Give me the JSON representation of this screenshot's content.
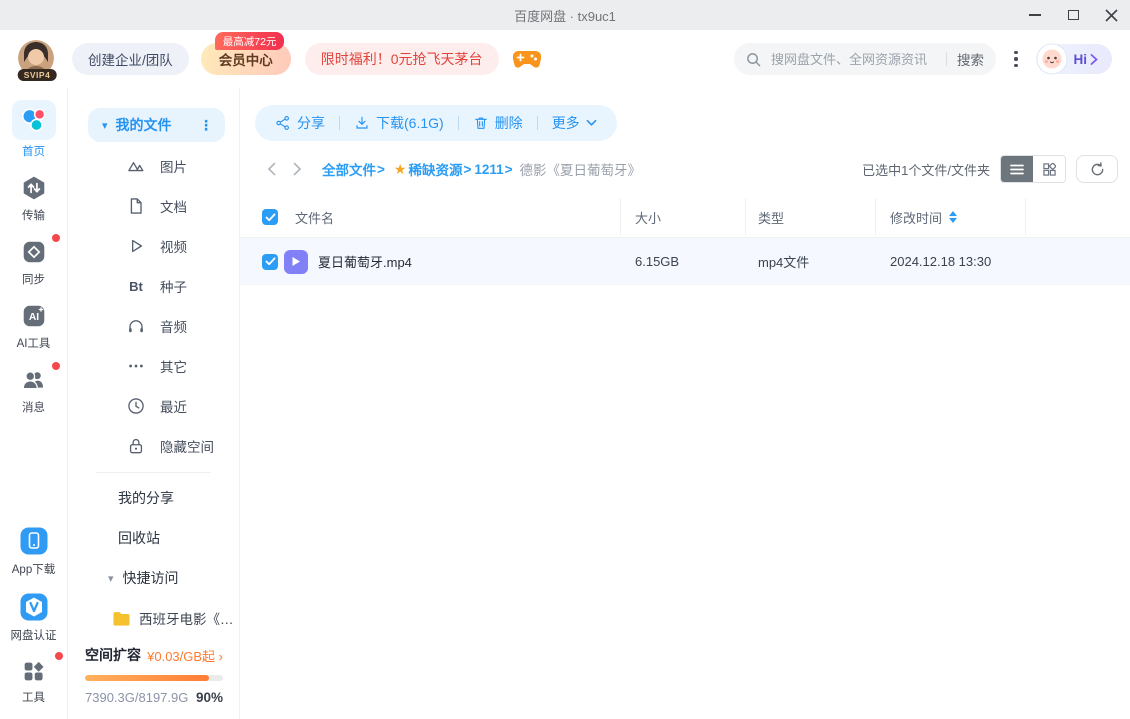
{
  "window": {
    "title": "百度网盘 · tx9uc1"
  },
  "header": {
    "avatar_badge": "SVIP4",
    "create_team": "创建企业/团队",
    "vip_center": "会员中心",
    "vip_ribbon": "最高减72元",
    "promo": "限时福利！0元抢飞天茅台",
    "search": {
      "placeholder": "搜网盘文件、全网资源资讯",
      "button": "搜索"
    },
    "assistant_label": "Hi"
  },
  "rail": {
    "items": [
      {
        "label": "首页"
      },
      {
        "label": "传输"
      },
      {
        "label": "同步"
      },
      {
        "label": "AI工具",
        "icon_text": "AI"
      },
      {
        "label": "消息"
      },
      {
        "label": "App下载"
      },
      {
        "label": "网盘认证"
      },
      {
        "label": "工具"
      }
    ]
  },
  "sidebar": {
    "my_files": "我的文件",
    "categories": [
      {
        "label": "图片"
      },
      {
        "label": "文档"
      },
      {
        "label": "视频"
      },
      {
        "label": "种子",
        "icon_text": "Bt"
      },
      {
        "label": "音频"
      },
      {
        "label": "其它"
      },
      {
        "label": "最近"
      },
      {
        "label": "隐藏空间"
      }
    ],
    "my_share": "我的分享",
    "recycle": "回收站",
    "quick_access": "快捷访问",
    "quick_item": "西班牙电影《…",
    "storage": {
      "title": "空间扩容",
      "price": "¥0.03/GB起 ›",
      "usage": "7390.3G/8197.9G",
      "percent": "90%"
    }
  },
  "toolbar": {
    "share": "分享",
    "download": "下载(6.1G)",
    "delete": "删除",
    "more": "更多"
  },
  "path": {
    "crumbs": [
      {
        "label": "全部文件"
      },
      {
        "label": "稀缺资源"
      },
      {
        "label": "1211"
      }
    ],
    "separator": ">",
    "current": "德影《夏日葡萄牙》",
    "selection": "已选中1个文件/文件夹"
  },
  "table": {
    "headers": {
      "name": "文件名",
      "size": "大小",
      "type": "类型",
      "modified": "修改时间"
    },
    "rows": [
      {
        "name": "夏日葡萄牙.mp4",
        "size": "6.15GB",
        "type": "mp4文件",
        "modified": "2024.12.18 13:30"
      }
    ]
  },
  "icons": {
    "caret_down": "▾",
    "dots_vertical": "⋮",
    "star": "★"
  },
  "colors": {
    "accent": "#2b9df4",
    "orange": "#ff7a2e",
    "danger": "#f5484d",
    "vip_text": "#5f3a20"
  }
}
